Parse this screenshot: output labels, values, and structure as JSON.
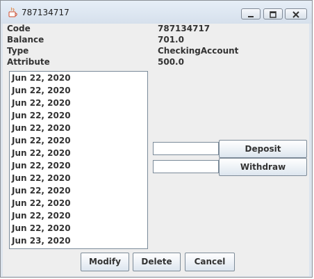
{
  "window": {
    "title": "787134717"
  },
  "info": {
    "code_label": "Code",
    "code_value": "787134717",
    "balance_label": "Balance",
    "balance_value": "701.0",
    "type_label": "Type",
    "type_value": "CheckingAccount",
    "attribute_label": "Attribute",
    "attribute_value": "500.0"
  },
  "transactions": [
    "Jun 22, 2020",
    "Jun 22, 2020",
    "Jun 22, 2020",
    "Jun 22, 2020",
    "Jun 22, 2020",
    "Jun 22, 2020",
    "Jun 22, 2020",
    "Jun 22, 2020",
    "Jun 22, 2020",
    "Jun 22, 2020",
    "Jun 22, 2020",
    "Jun 22, 2020",
    "Jun 22, 2020",
    "Jun 23, 2020"
  ],
  "actions": {
    "deposit_label": "Deposit",
    "withdraw_label": "Withdraw",
    "deposit_value": "",
    "withdraw_value": ""
  },
  "footer": {
    "modify_label": "Modify",
    "delete_label": "Delete",
    "cancel_label": "Cancel"
  }
}
